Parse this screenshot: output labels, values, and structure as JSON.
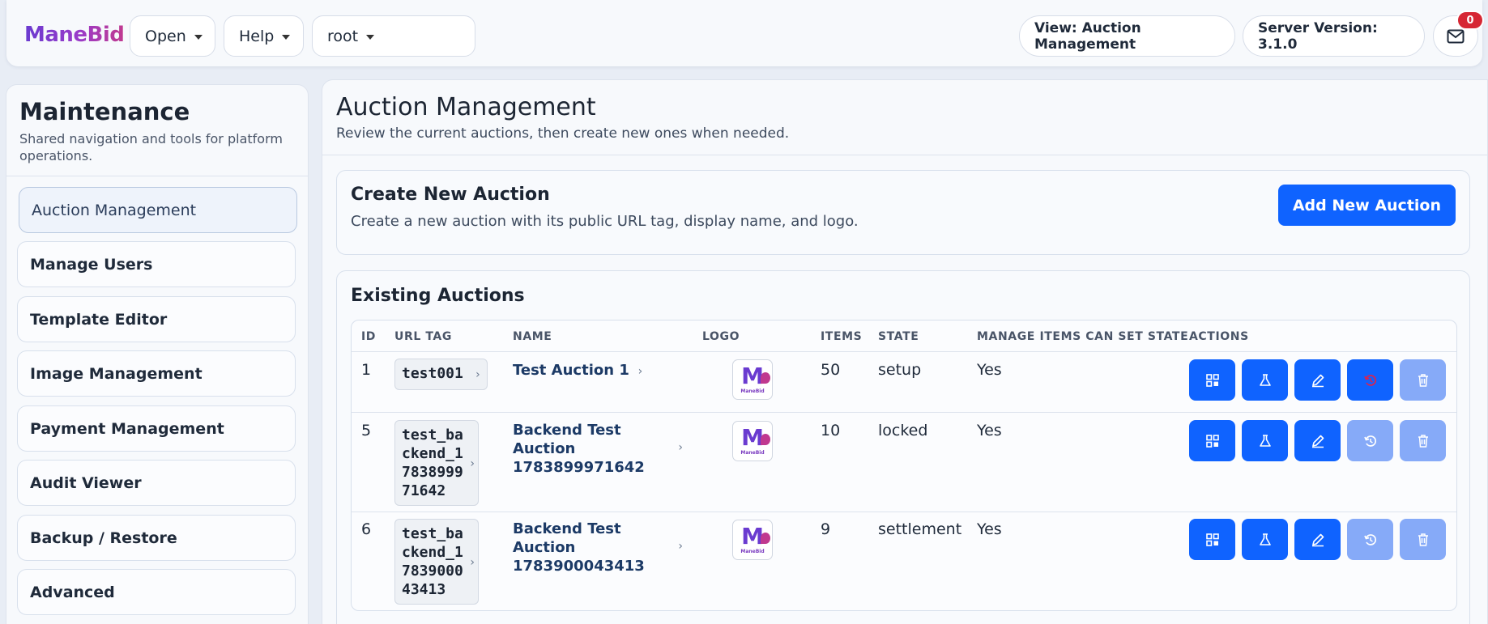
{
  "brand": "ManeBid",
  "topbar": {
    "open_label": "Open",
    "help_label": "Help",
    "user_label": "root",
    "view_label": "View: Auction Management",
    "server_version": "Server Version: 3.1.0",
    "notification_count": "0"
  },
  "sidebar": {
    "title": "Maintenance",
    "subtitle": "Shared navigation and tools for platform operations.",
    "items": [
      {
        "label": "Auction Management",
        "active": true
      },
      {
        "label": "Manage Users"
      },
      {
        "label": "Template Editor"
      },
      {
        "label": "Image Management"
      },
      {
        "label": "Payment Management"
      },
      {
        "label": "Audit Viewer"
      },
      {
        "label": "Backup / Restore"
      },
      {
        "label": "Advanced"
      }
    ]
  },
  "main": {
    "title": "Auction Management",
    "subtitle": "Review the current auctions, then create new ones when needed.",
    "create": {
      "title": "Create New Auction",
      "subtitle": "Create a new auction with its public URL tag, display name, and logo.",
      "button": "Add New Auction"
    },
    "existing": {
      "title": "Existing Auctions",
      "columns": [
        "ID",
        "URL TAG",
        "NAME",
        "LOGO",
        "ITEMS",
        "STATE",
        "MANAGE ITEMS CAN SET STATE",
        "ACTIONS"
      ],
      "rows": [
        {
          "id": "1",
          "url_tag_lines": [
            "test001"
          ],
          "name_lines": [
            "Test Auction 1"
          ],
          "logo_text": "ManeBid",
          "items": "50",
          "state": "setup",
          "can_set_state": "Yes"
        },
        {
          "id": "5",
          "url_tag_lines": [
            "test_ba",
            "ckend_1",
            "7838999",
            "71642"
          ],
          "name_lines": [
            "Backend Test",
            "Auction",
            "1783899971642"
          ],
          "logo_text": "ManeBid",
          "items": "10",
          "state": "locked",
          "can_set_state": "Yes"
        },
        {
          "id": "6",
          "url_tag_lines": [
            "test_ba",
            "ckend_1",
            "7839000",
            "43413"
          ],
          "name_lines": [
            "Backend Test",
            "Auction",
            "1783900043413"
          ],
          "logo_text": "ManeBid",
          "items": "9",
          "state": "settlement",
          "can_set_state": "Yes"
        }
      ]
    }
  },
  "colors": {
    "primary": "#0f63ff",
    "primary_disabled": "#86aaf8",
    "badge": "#d62734",
    "brand_start": "#6a3bd0",
    "brand_end": "#c0398f"
  },
  "icons": [
    "caret-down-icon",
    "mail-icon",
    "grid-icon",
    "flask-icon",
    "pencil-icon",
    "reset-icon",
    "trash-icon",
    "chevron-right-icon"
  ]
}
